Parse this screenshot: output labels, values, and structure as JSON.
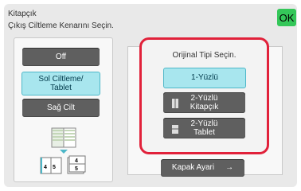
{
  "header": {
    "title": "Kitapçık",
    "subtitle": "Çıkış Ciltleme Kenarını Seçin.",
    "ok_label": "OK"
  },
  "binding": {
    "off_label": "Off",
    "left_label_line1": "Sol Ciltleme/",
    "left_label_line2": "Tablet",
    "right_label": "Sağ Cilt",
    "selected": "Sol Ciltleme/Tablet",
    "preview_left_pages": "4 5",
    "preview_right_pages": "4 5"
  },
  "original_type": {
    "prompt": "Orijinal Tipi Seçin.",
    "option1": "1-Yüzlü",
    "option2_line1": "2-Yüzlü",
    "option2_line2": "Kitapçık",
    "option3_line1": "2-Yüzlü",
    "option3_line2": "Tablet",
    "selected": "1-Yüzlü"
  },
  "footer": {
    "cover_label": "Kapak Ayari",
    "arrow": "→"
  },
  "colors": {
    "selected_fill": "#a8e6ee",
    "dark_button": "#5f5f5f",
    "highlight_red": "#e1213a",
    "ok_green": "#34c759"
  }
}
